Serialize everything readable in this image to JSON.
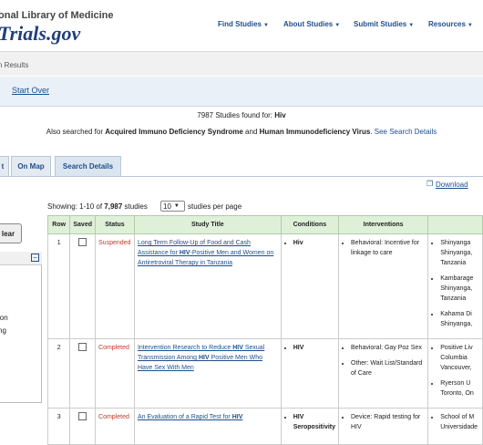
{
  "header": {
    "nlm": "onal Library of Medicine",
    "logo": "Trials.gov",
    "nav": [
      "Find Studies",
      "About Studies",
      "Submit Studies",
      "Resources"
    ],
    "caret": "▼"
  },
  "breadcrumb": "n Results",
  "toolbar": {
    "start_over": "Start Over"
  },
  "summary": {
    "found_prefix": "7987 Studies found for: ",
    "found_term": "Hiv",
    "also_prefix": "Also searched for ",
    "also_term1": "Acquired Immuno Deficiency Syndrome",
    "also_and": " and ",
    "also_term2": "Human Immunodeficiency Virus",
    "also_period": ". ",
    "also_link": "See Search Details"
  },
  "tabs": [
    "t",
    "On Map",
    "Search Details"
  ],
  "download": {
    "label": "Download",
    "icon": "download-icon"
  },
  "left_panel": {
    "clear": "lear",
    "minus": "−",
    "lines": [
      "ion",
      "ng"
    ]
  },
  "showing": {
    "prefix": "Showing: 1-10 of ",
    "total": "7,987",
    "suffix": " studies",
    "per_page_value": "10",
    "per_page_label": "studies per page"
  },
  "table": {
    "headers": [
      "Row",
      "Saved",
      "Status",
      "Study Title",
      "Conditions",
      "Interventions",
      ""
    ],
    "rows": [
      {
        "row": "1",
        "status": "Suspended",
        "title_pre": "Long Term Follow-Up of Food and Cash Assistance for ",
        "title_hl": "HIV",
        "title_post": "-Positive Men and Women on Antiretroviral Therapy in Tanzania",
        "conditions": [
          "Hiv"
        ],
        "interventions": [
          "Behavioral: Incentive for linkage to care"
        ],
        "locations": [
          "Shinyanga Shinyanga, Tanzania",
          "Kambarage Shinyanga, Tanzania",
          "Kahama Di Shinyanga,"
        ]
      },
      {
        "row": "2",
        "status": "Completed",
        "title_pre": "Intervention Research to Reduce ",
        "title_hl": "HIV",
        "title_mid": " Sexual Transmission Among ",
        "title_hl2": "HIV",
        "title_post": " Positive Men Who Have Sex With Men",
        "conditions": [
          "HIV"
        ],
        "interventions": [
          "Behavioral: Gay Poz Sex",
          "Other: Wait List/Standard of Care"
        ],
        "locations": [
          "Positive Liv Columbia Vancouver,",
          "Ryerson U Toronto, On"
        ]
      },
      {
        "row": "3",
        "status": "Completed",
        "title_pre": "An Evaluation of a Rapid Test for ",
        "title_hl": "HIV",
        "title_post": "",
        "conditions": [
          "HIV Seropositivity"
        ],
        "interventions": [
          "Device: Rapid testing for HIV"
        ],
        "locations": [
          "School of M Universidade"
        ]
      }
    ]
  }
}
